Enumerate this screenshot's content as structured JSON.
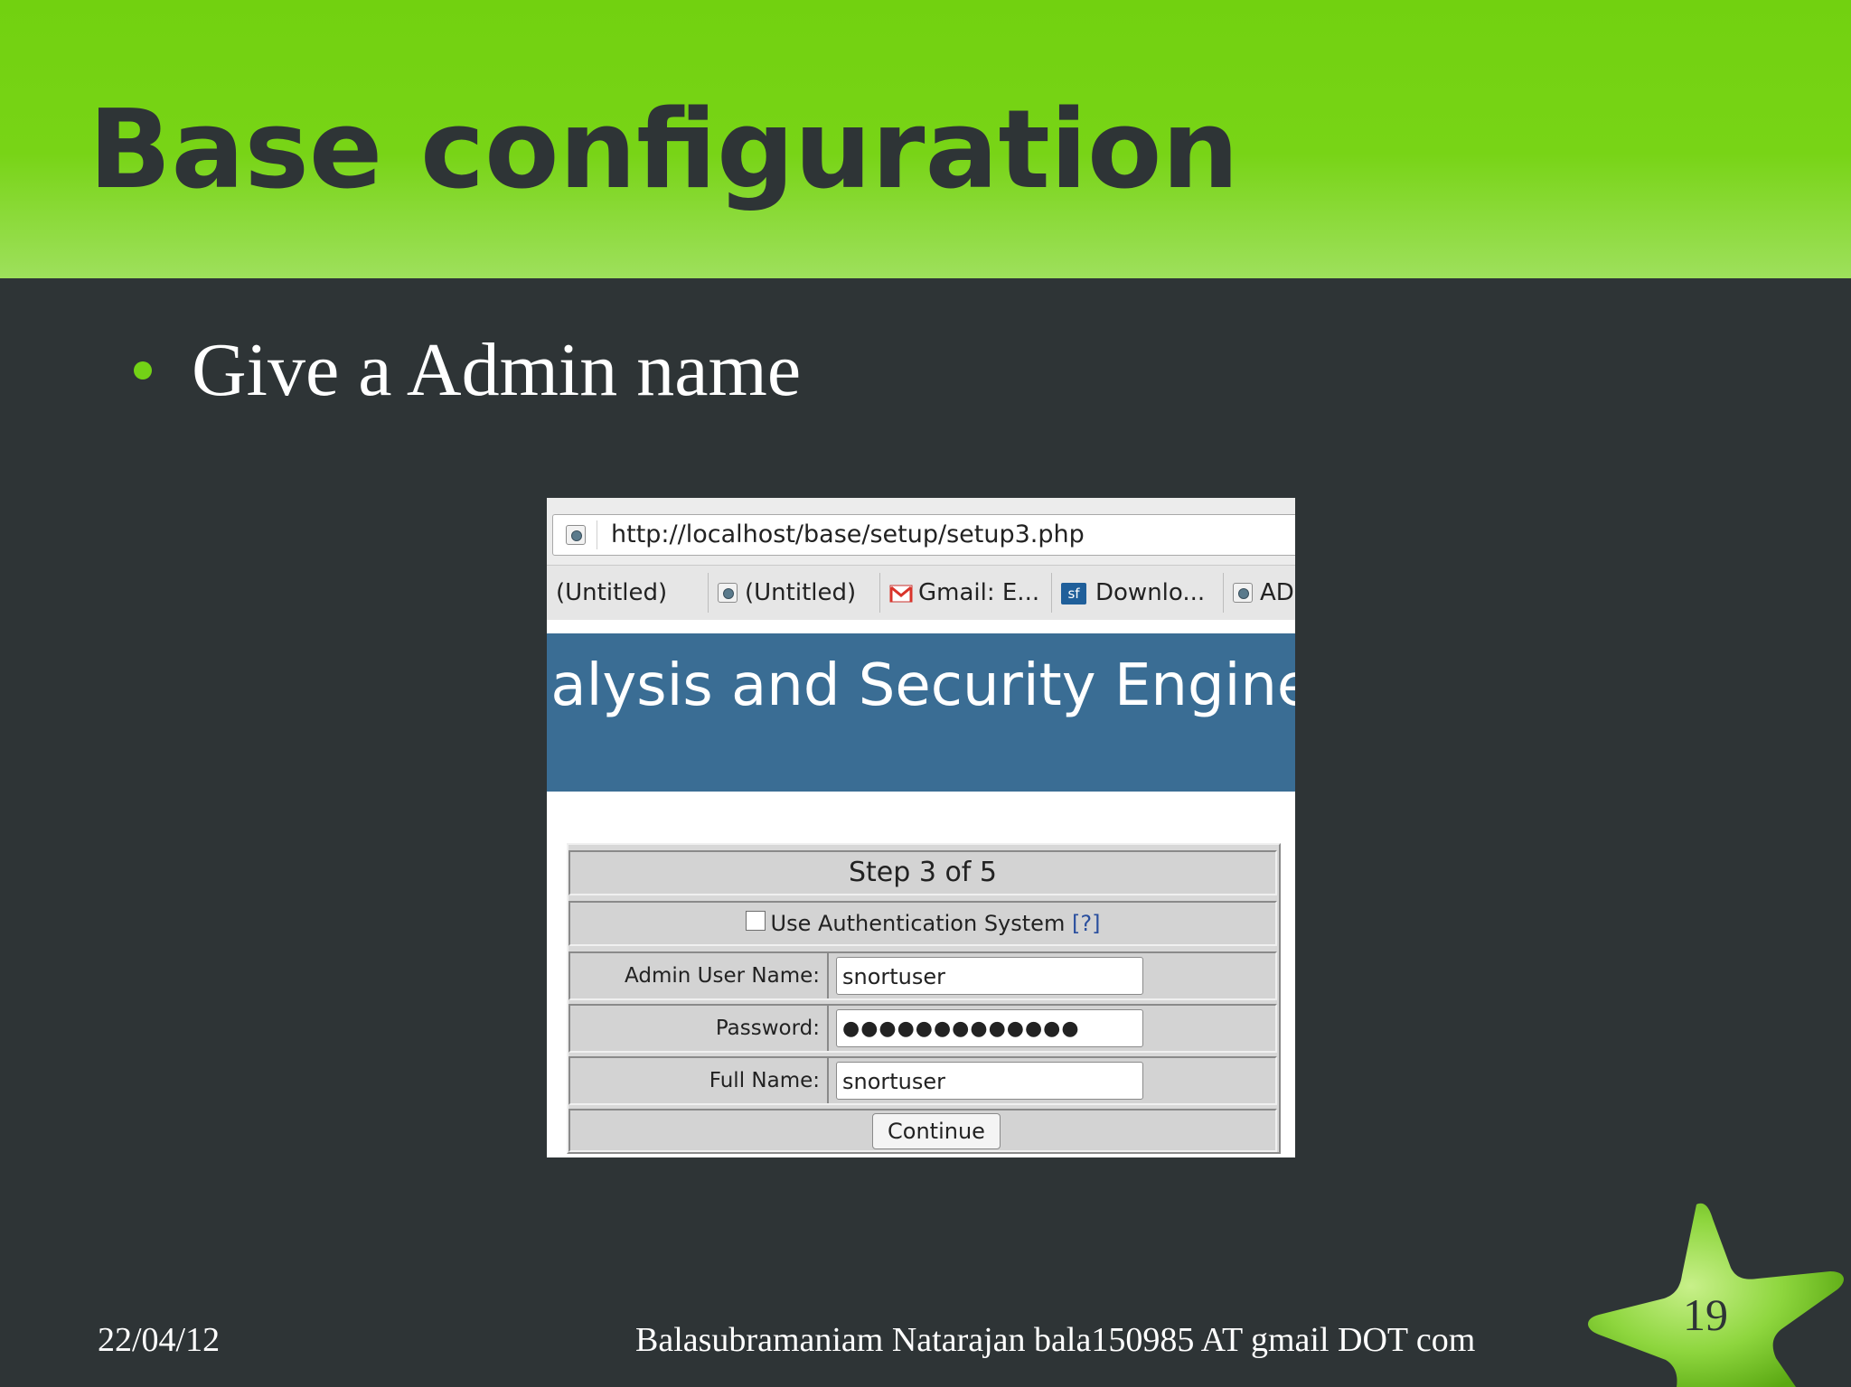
{
  "slide": {
    "title": "Base configuration",
    "bullets": [
      "Give a Admin name"
    ],
    "footer": {
      "date": "22/04/12",
      "author": "Balasubramaniam Natarajan bala150985 AT gmail DOT com",
      "page_number": "19"
    },
    "colors": {
      "header_green": "#73d216",
      "background": "#2e3436",
      "banner_blue": "#3a6d94"
    }
  },
  "browser": {
    "url": "http://localhost/base/setup/setup3.php",
    "tabs": [
      {
        "label": "(Untitled)",
        "icon": "page-icon"
      },
      {
        "label": "(Untitled)",
        "icon": "page-icon"
      },
      {
        "label": "Gmail: E...",
        "icon": "gmail-icon"
      },
      {
        "label": "Downlo...",
        "icon": "sourceforge-icon"
      },
      {
        "label": "ADO",
        "icon": "page-icon"
      }
    ],
    "sf_icon_text": "sf"
  },
  "base_page": {
    "banner_text": "Analysis and Security Engine (BASE)",
    "step_label": "Step 3 of 5",
    "auth_label": "Use Authentication System",
    "auth_help": "[?]",
    "auth_checked": false,
    "fields": {
      "admin_user_label": "Admin User Name:",
      "admin_user_value": "snortuser",
      "password_label": "Password:",
      "password_value": "●●●●●●●●●●●●●",
      "full_name_label": "Full Name:",
      "full_name_value": "snortuser"
    },
    "continue_label": "Continue"
  }
}
